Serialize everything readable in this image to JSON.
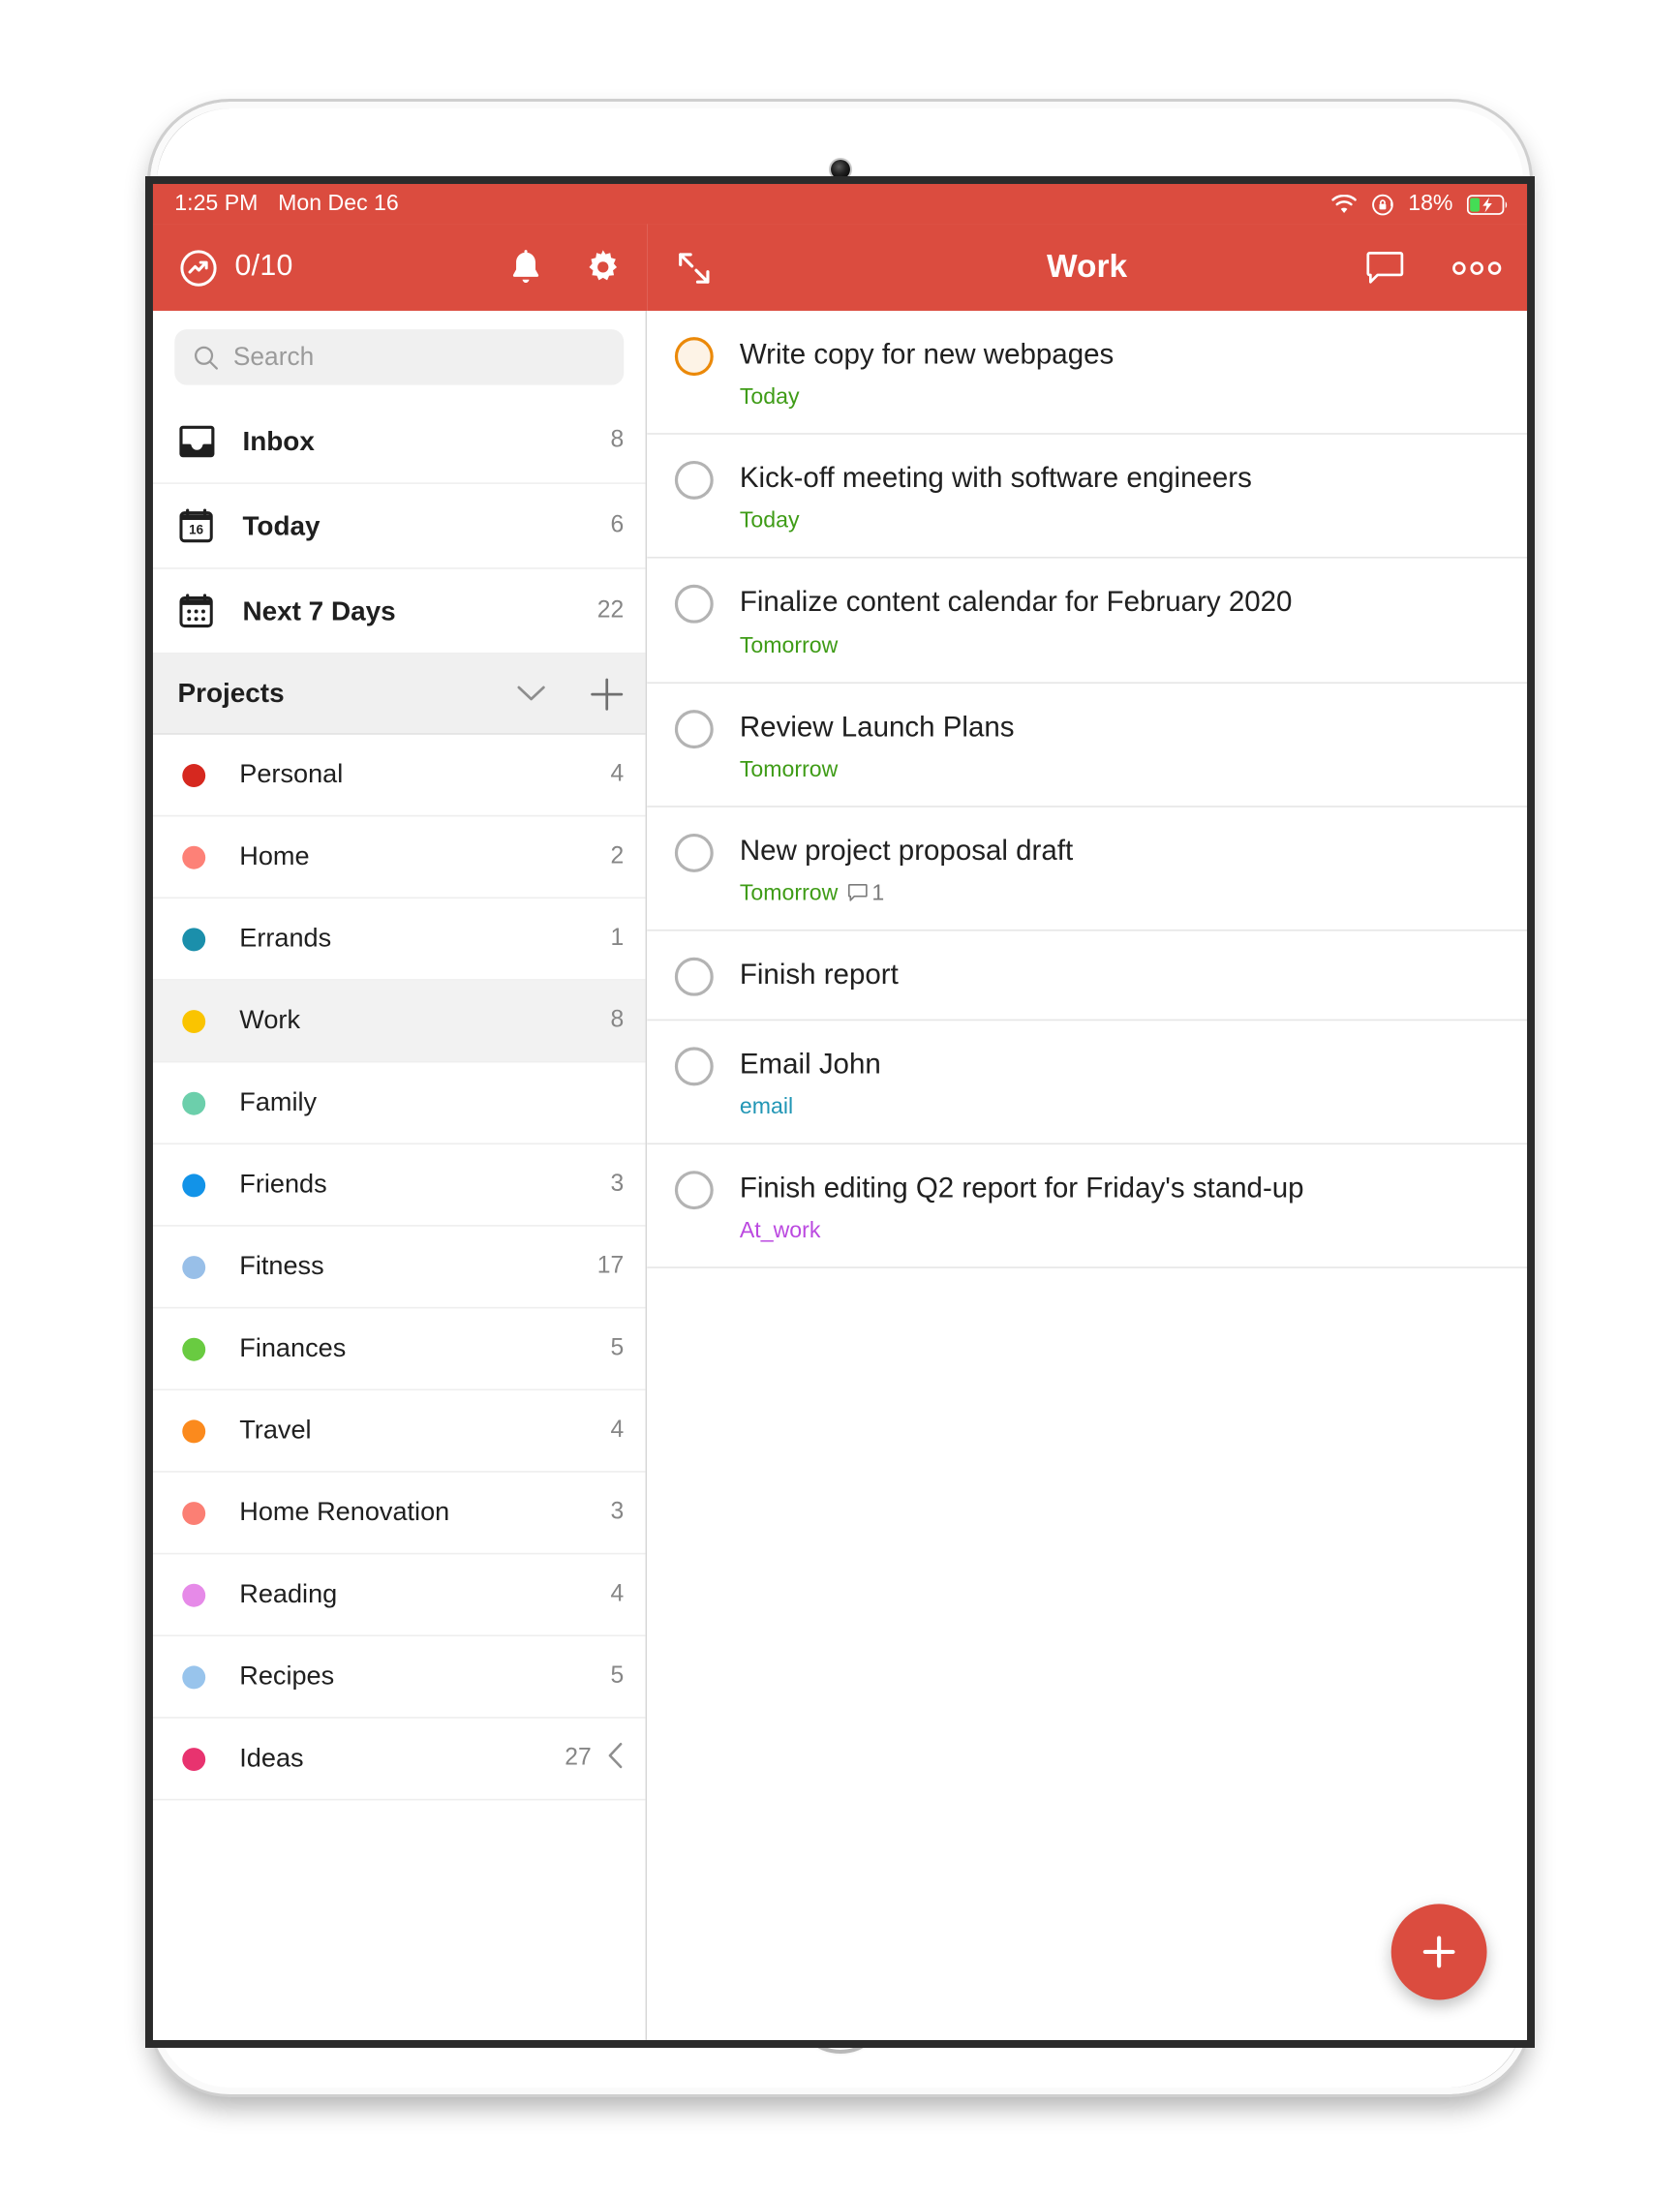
{
  "theme": {
    "accent": "#db4c3f",
    "due_green": "#3f9c17",
    "highlight_orange": "#eb8909"
  },
  "status_bar": {
    "time": "1:25 PM",
    "date": "Mon Dec 16",
    "wifi_icon": "wifi-icon",
    "rotation_lock_icon": "rotation-lock-icon",
    "battery_percent": "18%",
    "battery_icon": "battery-charging-icon"
  },
  "left_nav": {
    "karma_icon": "productivity-icon",
    "karma_count": "0/10",
    "notifications_icon": "bell-icon",
    "settings_icon": "gear-icon"
  },
  "right_nav": {
    "expand_icon": "expand-icon",
    "title": "Work",
    "comments_icon": "comment-icon",
    "more_icon": "more-options-icon"
  },
  "search": {
    "placeholder": "Search",
    "value": "",
    "icon": "search-icon"
  },
  "sidebar": {
    "filters": [
      {
        "label": "Inbox",
        "count": "8",
        "icon": "inbox-icon"
      },
      {
        "label": "Today",
        "count": "6",
        "icon": "calendar-today-icon",
        "day": "16"
      },
      {
        "label": "Next 7 Days",
        "count": "22",
        "icon": "calendar-week-icon"
      }
    ],
    "projects_header": {
      "title": "Projects",
      "collapse_icon": "chevron-down-icon",
      "add_icon": "plus-icon"
    },
    "projects": [
      {
        "label": "Personal",
        "count": "4",
        "color": "#d6281f",
        "selected": false
      },
      {
        "label": "Home",
        "count": "2",
        "color": "#fd8177",
        "selected": false
      },
      {
        "label": "Errands",
        "count": "1",
        "color": "#1b8fab",
        "selected": false
      },
      {
        "label": "Work",
        "count": "8",
        "color": "#fac400",
        "selected": true
      },
      {
        "label": "Family",
        "count": "",
        "color": "#6ccfab",
        "selected": false
      },
      {
        "label": "Friends",
        "count": "3",
        "color": "#1293e8",
        "selected": false
      },
      {
        "label": "Fitness",
        "count": "17",
        "color": "#98bfe8",
        "selected": false
      },
      {
        "label": "Finances",
        "count": "5",
        "color": "#69cb41",
        "selected": false
      },
      {
        "label": "Travel",
        "count": "4",
        "color": "#fb8a1d",
        "selected": false
      },
      {
        "label": "Home Renovation",
        "count": "3",
        "color": "#fb7f74",
        "selected": false
      },
      {
        "label": "Reading",
        "count": "4",
        "color": "#e68ae8",
        "selected": false
      },
      {
        "label": "Recipes",
        "count": "5",
        "color": "#98c4ec",
        "selected": false
      },
      {
        "label": "Ideas",
        "count": "27",
        "color": "#e8336f",
        "selected": false,
        "collapse_icon": "chevron-left-icon"
      }
    ]
  },
  "tasks": [
    {
      "title": "Write copy for new webpages",
      "due": "Today",
      "due_color": "#3f9c17",
      "checkbox_highlighted": true,
      "label": "",
      "comments": ""
    },
    {
      "title": "Kick-off meeting with software engineers",
      "due": "Today",
      "due_color": "#3f9c17",
      "checkbox_highlighted": false,
      "label": "",
      "comments": ""
    },
    {
      "title": "Finalize content calendar for February 2020",
      "due": "Tomorrow",
      "due_color": "#3f9c17",
      "checkbox_highlighted": false,
      "label": "",
      "comments": ""
    },
    {
      "title": "Review Launch Plans",
      "due": "Tomorrow",
      "due_color": "#3f9c17",
      "checkbox_highlighted": false,
      "label": "",
      "comments": ""
    },
    {
      "title": "New project proposal draft",
      "due": "Tomorrow",
      "due_color": "#3f9c17",
      "checkbox_highlighted": false,
      "label": "",
      "comments": "1"
    },
    {
      "title": "Finish report",
      "due": "",
      "due_color": "#3f9c17",
      "checkbox_highlighted": false,
      "label": "",
      "comments": ""
    },
    {
      "title": "Email John",
      "due": "",
      "due_color": "#3f9c17",
      "checkbox_highlighted": false,
      "label": "email",
      "label_color": "#2196b5",
      "comments": ""
    },
    {
      "title": "Finish editing Q2 report for Friday's stand-up",
      "due": "",
      "due_color": "#3f9c17",
      "checkbox_highlighted": false,
      "label": "At_work",
      "label_color": "#bb49e0",
      "comments": ""
    }
  ],
  "fab": {
    "icon": "plus-icon",
    "label": "Add task"
  }
}
